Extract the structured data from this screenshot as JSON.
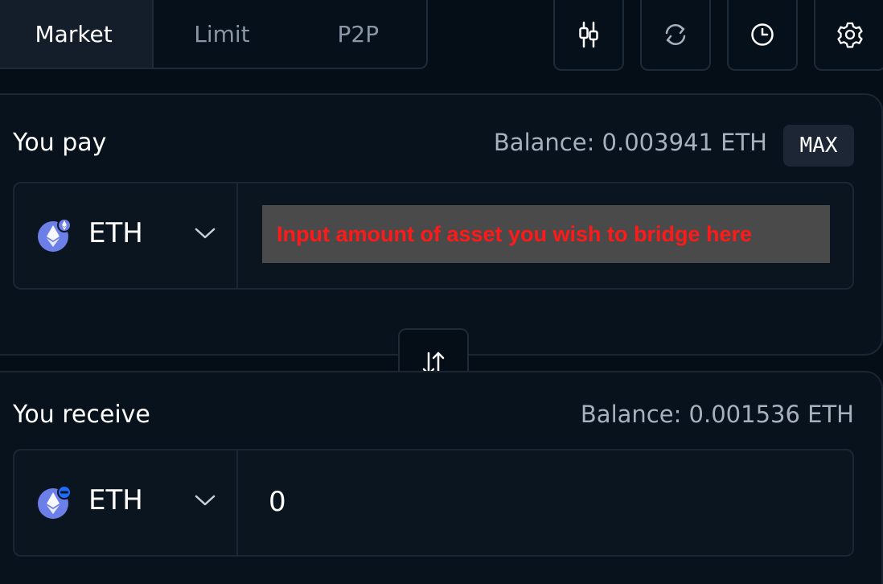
{
  "tabs": {
    "market": "Market",
    "limit": "Limit",
    "p2p": "P2P"
  },
  "toolbar_icons": [
    "chart-settings-icon",
    "refresh-icon",
    "history-icon",
    "settings-icon"
  ],
  "pay": {
    "label": "You pay",
    "balance": "Balance: 0.003941  ETH",
    "max_label": "MAX",
    "token": "ETH",
    "amount_prompt": "Input amount of asset you wish to bridge here"
  },
  "receive": {
    "label": "You receive",
    "balance": "Balance: 0.001536 ETH",
    "token": "ETH",
    "amount": "0"
  },
  "colors": {
    "background": "#050d17",
    "panel": "#08121d",
    "border": "#1f2a37",
    "muted_text": "#a7b0bc",
    "eth_logo": "#6c7fe8",
    "highlight_text": "#ff1a1a",
    "network_badge_blue": "#1f6dff"
  }
}
